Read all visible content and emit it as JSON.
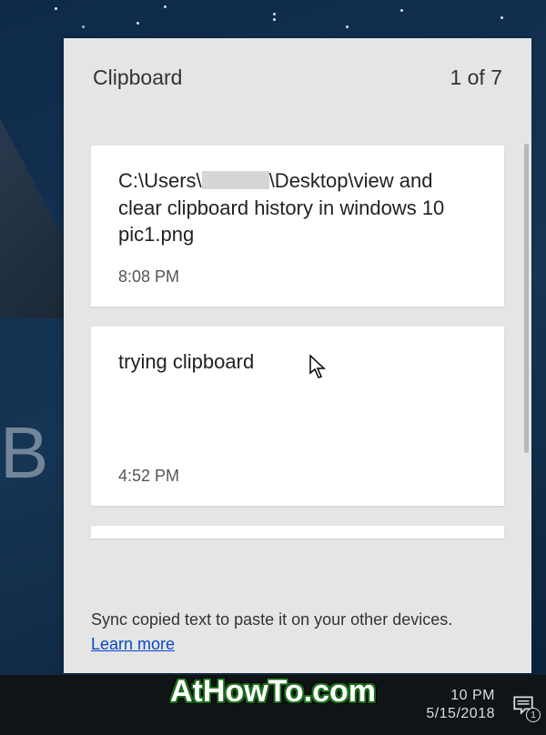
{
  "clipboard": {
    "title": "Clipboard",
    "counter": "1 of 7",
    "items": [
      {
        "text_prefix": "C:\\Users\\",
        "text_suffix": "\\Desktop\\view and clear clipboard history in windows 10 pic1.png",
        "time": "8:08 PM"
      },
      {
        "text": "trying clipboard",
        "time": "4:52 PM"
      }
    ],
    "footer_text": "Sync copied text to paste it on your other devices.",
    "footer_link": "Learn more"
  },
  "background_letter": "B",
  "taskbar": {
    "clock_time": "10 PM",
    "clock_date": "5/15/2018",
    "notification_count": "1"
  },
  "watermark": "AtHowTo.com"
}
